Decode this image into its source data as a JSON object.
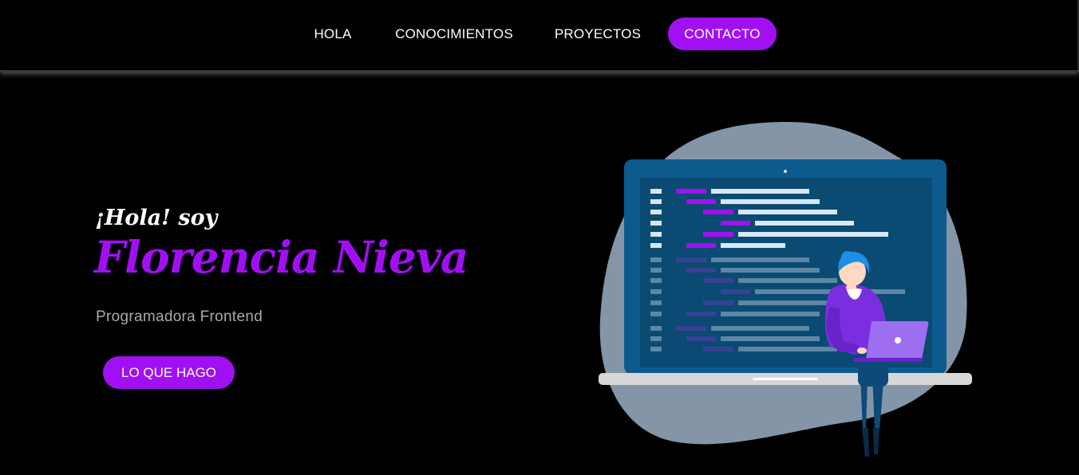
{
  "nav": {
    "items": [
      {
        "label": "HOLA"
      },
      {
        "label": "CONOCIMIENTOS"
      },
      {
        "label": "PROYECTOS"
      },
      {
        "label": "CONTACTO",
        "active": true
      }
    ]
  },
  "hero": {
    "greeting": "¡Hola! soy",
    "name": "Florencia Nieva",
    "role": "Programadora Frontend",
    "cta_label": "LO QUE HAGO"
  },
  "illustration": {
    "icon": "developer-laptop-illustration"
  },
  "colors": {
    "background": "#000000",
    "accent": "#a010f2",
    "text": "#ffffff",
    "muted_text": "#a9a9a9",
    "blob": "#8395a7",
    "screen": "#0b4a72",
    "laptop_frame": "#0d5a8f"
  }
}
